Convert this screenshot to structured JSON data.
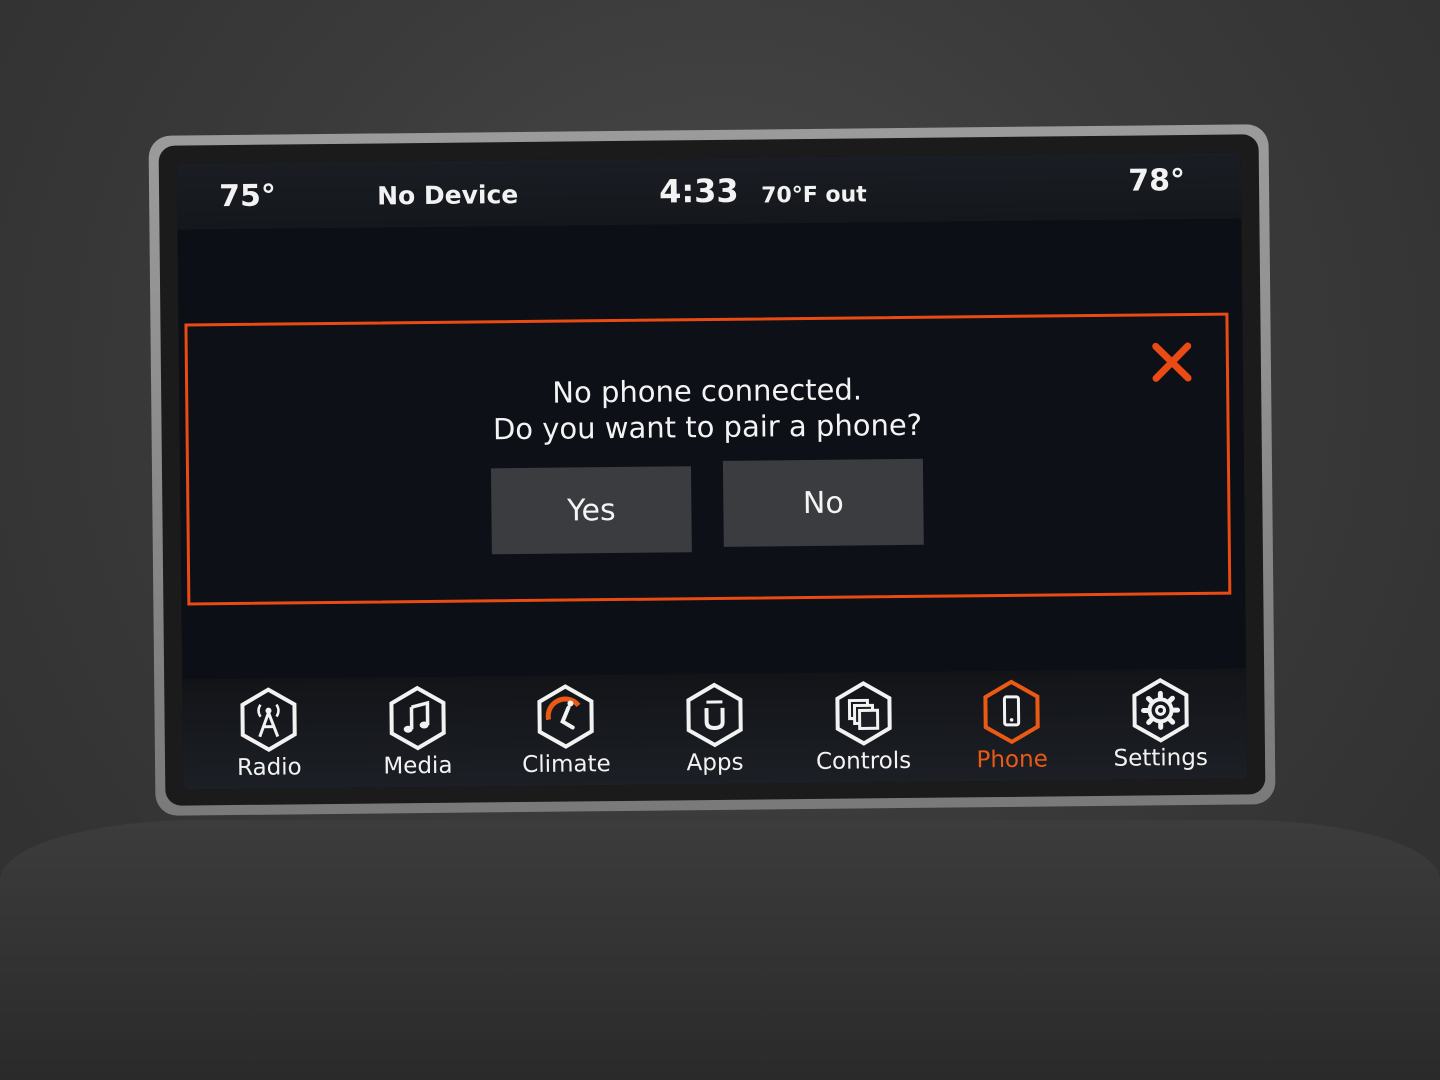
{
  "status_bar": {
    "temp_left": "75°",
    "device": "No Device",
    "clock": "4:33",
    "outside_temp": "70°F out",
    "temp_right": "78°"
  },
  "dialog": {
    "line1": "No phone connected.",
    "line2": "Do you want to pair a phone?",
    "yes_label": "Yes",
    "no_label": "No",
    "close_icon": "close-icon",
    "accent_color": "#ea4a14"
  },
  "nav": {
    "items": [
      {
        "label": "Radio",
        "icon": "radio-tower-icon"
      },
      {
        "label": "Media",
        "icon": "music-note-icon"
      },
      {
        "label": "Climate",
        "icon": "climate-seat-icon"
      },
      {
        "label": "Apps",
        "icon": "apps-icon"
      },
      {
        "label": "Controls",
        "icon": "controls-icon"
      },
      {
        "label": "Phone",
        "icon": "phone-icon"
      },
      {
        "label": "Settings",
        "icon": "gear-icon"
      }
    ],
    "active": "Phone",
    "active_color": "#ea5a14"
  }
}
